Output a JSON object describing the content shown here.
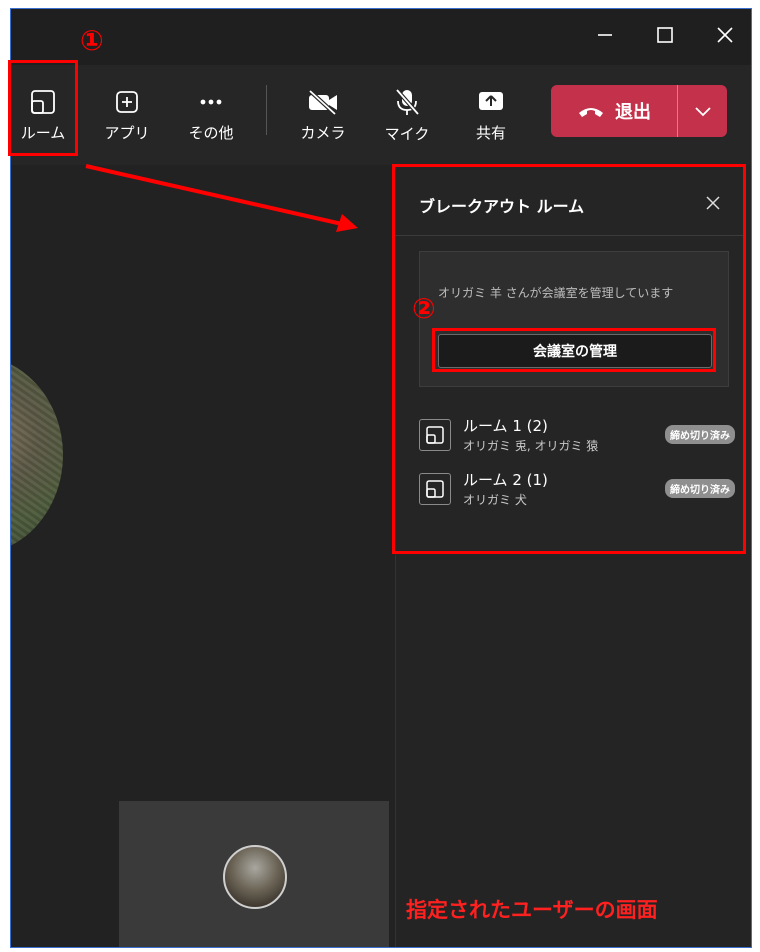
{
  "window": {
    "controls": [
      "minimize-icon",
      "maximize-icon",
      "close-icon"
    ]
  },
  "toolbar": {
    "rooms_label": "ルーム",
    "apps_label": "アプリ",
    "more_label": "その他",
    "camera_label": "カメラ",
    "mic_label": "マイク",
    "share_label": "共有",
    "leave_label": "退出"
  },
  "panel": {
    "title": "ブレークアウト ルーム",
    "manager_text": "オリガミ 羊 さんが会議室を管理しています",
    "manage_button": "会議室の管理",
    "rooms": [
      {
        "name": "ルーム 1 (2)",
        "members": "オリガミ 兎, オリガミ 猿",
        "badge": "締め切り済み"
      },
      {
        "name": "ルーム 2 (1)",
        "members": "オリガミ 犬",
        "badge": "締め切り済み"
      }
    ]
  },
  "annotations": {
    "step1": "①",
    "step2": "②",
    "caption": "指定されたユーザーの画面"
  },
  "colors": {
    "leave": "#c4314b",
    "annotation": "#ff0000",
    "background": "#1f1f1f"
  }
}
